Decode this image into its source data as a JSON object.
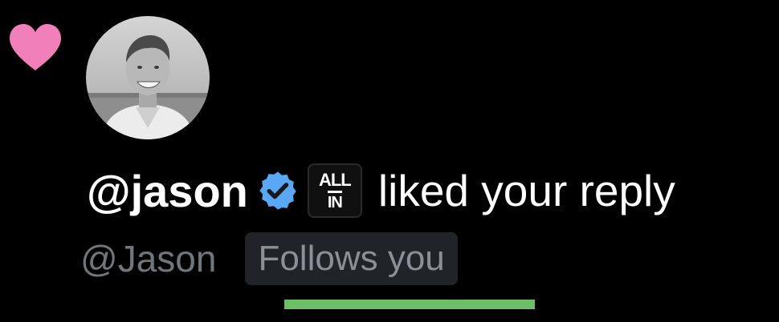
{
  "notification": {
    "type_icon": "heart-icon",
    "type_icon_color": "#f17fb9",
    "avatar": "profile-photo",
    "user_handle_bold": "@jason",
    "verified_icon": "verified-badge-icon",
    "verified_color": "#5aa7f5",
    "affiliation_badge": {
      "line1": "ALL",
      "line2": "IN"
    },
    "action_text": "liked your reply",
    "sub_handle": "@Jason",
    "follows_badge": "Follows you"
  },
  "annotation": {
    "underline_color": "#6dbf67"
  }
}
